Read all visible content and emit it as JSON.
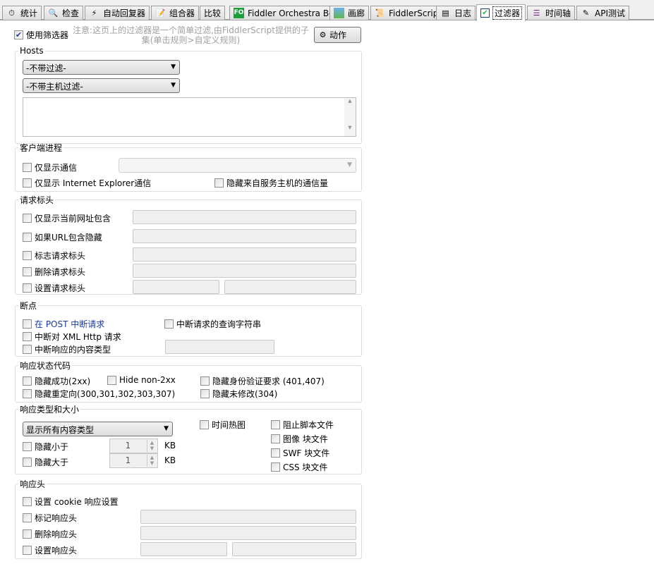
{
  "tabs": [
    {
      "label": "统计",
      "icon": "stopwatch-icon"
    },
    {
      "label": "检查",
      "icon": "magnifier-icon"
    },
    {
      "label": "自动回复器",
      "icon": "lightning-icon"
    },
    {
      "label": "组合器",
      "icon": "pencil-form-icon"
    },
    {
      "label": "比较",
      "icon": ""
    },
    {
      "label": "Fiddler Orchestra Beta",
      "icon": "fo-icon",
      "icon_text": "FO"
    },
    {
      "label": "画廊",
      "icon": "picture-icon"
    },
    {
      "label": "FiddlerScript",
      "icon": "script-scroll-icon"
    },
    {
      "label": "日志",
      "icon": "document-icon"
    },
    {
      "label": "过滤器",
      "icon": "checkbox-icon",
      "active": true
    },
    {
      "label": "时间轴",
      "icon": "timeline-icon"
    },
    {
      "label": "API测试",
      "icon": "pencil-icon"
    }
  ],
  "top": {
    "use_filters": "使用筛选器",
    "use_filters_checked": true,
    "note_line1": "注意:这页上的过滤器是一个简单过滤,由FiddlerScript提供的子",
    "note_line2": "集(单击规则>自定义规则)",
    "action_button": "动作"
  },
  "hosts": {
    "title": "Hosts",
    "zone_filter": "-不带过滤-",
    "host_filter": "-不带主机过滤-",
    "hosts_text": ""
  },
  "client": {
    "title": "客户端进程",
    "only_traffic": "仅显示通信",
    "only_ie": "仅显示 Internet Explorer通信",
    "hide_service": "隐藏来自服务主机的通信量"
  },
  "request_headers": {
    "title": "请求标头",
    "show_url_contains": "仅显示当前网址包含",
    "hide_url_contains": "如果URL包含隐藏",
    "flag_header": "标志请求标头",
    "delete_header": "删除请求标头",
    "set_header": "设置请求标头"
  },
  "breakpoints": {
    "title": "断点",
    "on_post": "在 POST 中断请求",
    "on_xml": "中断对 XML Http 请求",
    "on_content_type": "中断响应的内容类型",
    "on_query": "中断请求的查询字符串"
  },
  "status": {
    "title": "响应状态代码",
    "hide_success": "隐藏成功(2xx)",
    "hide_non2xx": "Hide non-2xx",
    "hide_auth": "隐藏身份验证要求 (401,407)",
    "hide_redirect": "隐藏重定向(300,301,302,303,307)",
    "hide_not_modified": "隐藏未修改(304)"
  },
  "type_size": {
    "title": "响应类型和大小",
    "content_type": "显示所有内容类型",
    "hide_smaller": "隐藏小于",
    "hide_larger": "隐藏大于",
    "smaller_value": "1",
    "larger_value": "1",
    "unit": "KB",
    "time_heatmap": "时间热图",
    "block_script": "阻止脚本文件",
    "block_image": "图像 块文件",
    "block_swf": "SWF 块文件",
    "block_css": "CSS 块文件"
  },
  "response_headers": {
    "title": "响应头",
    "set_cookie": "设置 cookie 响应设置",
    "flag_header": "标记响应头",
    "delete_header": "删除响应头",
    "set_header": "设置响应头"
  }
}
